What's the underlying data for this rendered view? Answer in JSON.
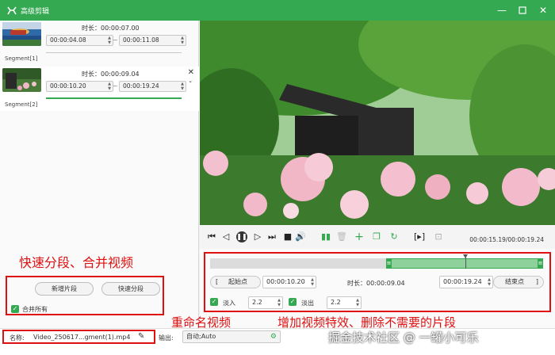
{
  "window": {
    "title": "高级剪辑",
    "controls": [
      "minimize-icon",
      "maximize-icon",
      "close-icon"
    ]
  },
  "segments": [
    {
      "label": "Segment[1]",
      "duration": "时长：00:00:07.00",
      "start": "00:00:04.08",
      "end": "00:00:11.08",
      "separator": "~"
    },
    {
      "label": "Segment[2]",
      "duration": "时长：00:00:09.04",
      "start": "00:00:10.20",
      "end": "00:00:19.24",
      "separator": "~"
    }
  ],
  "left_actions": {
    "add_segment": "新增片段",
    "quick_split": "快速分段",
    "merge_all": "合并所有"
  },
  "player": {
    "time_readout": "00:00:15.19/00:00:19.24",
    "controls": [
      "jump-start-icon",
      "prev-frame-icon",
      "pause-icon",
      "next-frame-icon",
      "jump-end-icon",
      "stop-icon",
      "volume-icon",
      "split-icon",
      "delete-icon",
      "add-icon",
      "copy-icon",
      "reset-icon",
      "mark-in-out-icon",
      "crop-icon"
    ]
  },
  "trim": {
    "start_button": "起始点",
    "start_bracket": "[",
    "start_value": "00:00:10.20",
    "duration_label": "时长：00:00:09.04",
    "end_value": "00:00:19.24",
    "end_button": "结束点",
    "end_bracket": "]",
    "fade_in_label": "淡入",
    "fade_in_value": "2.2",
    "fade_out_label": "淡出",
    "fade_out_value": "2.2",
    "range_start_fraction": 0.528,
    "range_end_fraction": 1.0,
    "playhead_fraction": 0.767
  },
  "bottom": {
    "name_label": "名称:",
    "name_value": "Video_250617...gment(1).mp4",
    "output_label": "输出:",
    "output_value": "自动;Auto",
    "watermark": "掘金技术社区 @ 一罐小可乐"
  },
  "annotations": {
    "quick_split_merge": "快速分段、合并视频",
    "rename": "重命名视频",
    "effects": "增加视频特效、删除不需要的片段"
  },
  "colors": {
    "accent": "#35a852",
    "annotation": "#e01010"
  }
}
